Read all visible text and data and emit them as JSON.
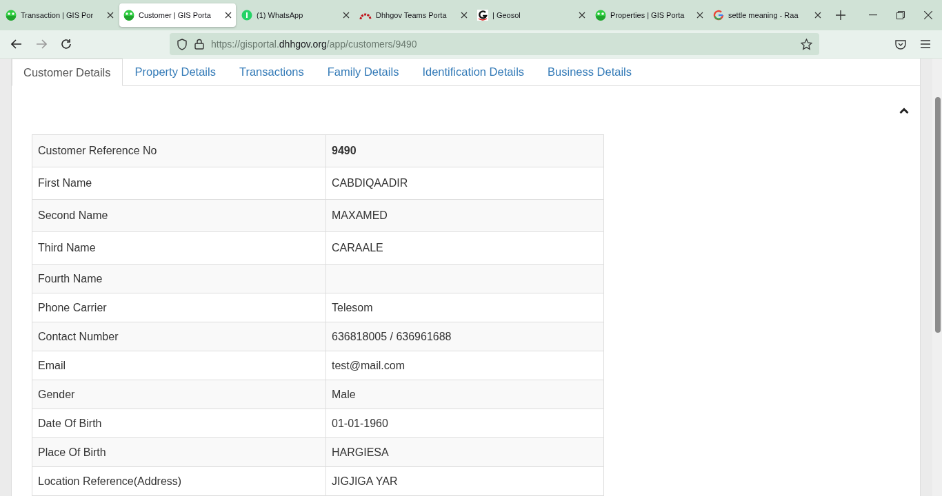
{
  "browser_tabs": [
    {
      "title": "Transaction | GIS Por",
      "kind": "gis",
      "selected": false
    },
    {
      "title": "Customer | GIS Porta",
      "kind": "gis",
      "selected": true
    },
    {
      "title": "(1) WhatsApp",
      "kind": "whatsapp",
      "selected": false
    },
    {
      "title": "Dhhgov Teams Porta",
      "kind": "arc",
      "selected": false
    },
    {
      "title": "| Geosol",
      "kind": "g",
      "selected": false
    },
    {
      "title": "Properties | GIS Porta",
      "kind": "gis",
      "selected": false
    },
    {
      "title": "settle meaning - Raa",
      "kind": "google",
      "selected": false
    }
  ],
  "address_bar": {
    "prefix": "https://gisportal.",
    "domain": "dhhgov.org",
    "path": "/app/customers/9490"
  },
  "page_tabs": [
    {
      "label": "Customer Details",
      "selected": true
    },
    {
      "label": "Property Details",
      "selected": false
    },
    {
      "label": "Transactions",
      "selected": false
    },
    {
      "label": "Family Details",
      "selected": false
    },
    {
      "label": "Identification Details",
      "selected": false
    },
    {
      "label": "Business Details",
      "selected": false
    }
  ],
  "details": [
    {
      "label": "Customer Reference No",
      "value": "9490",
      "bold": true
    },
    {
      "label": "First Name",
      "value": "CABDIQAADIR",
      "bold": false
    },
    {
      "label": "Second Name",
      "value": "MAXAMED",
      "bold": false
    },
    {
      "label": "Third Name",
      "value": "CARAALE",
      "bold": false
    },
    {
      "label": "Fourth Name"
    },
    {
      "label": "Phone Carrier",
      "value": "Telesom",
      "bold": false
    },
    {
      "label": "Contact Number",
      "value": "636818005 / 636961688",
      "bold": false
    },
    {
      "label": "Email",
      "value": "test@mail.com",
      "bold": false
    },
    {
      "label": "Gender",
      "value": "Male",
      "bold": false
    },
    {
      "label": "Date Of Birth",
      "value": "01-01-1960",
      "bold": false
    },
    {
      "label": "Place Of Birth",
      "value": "HARGIESA",
      "bold": false
    },
    {
      "label": "Location Reference(Address)",
      "value": "JIGJIGA YAR",
      "bold": false
    }
  ]
}
